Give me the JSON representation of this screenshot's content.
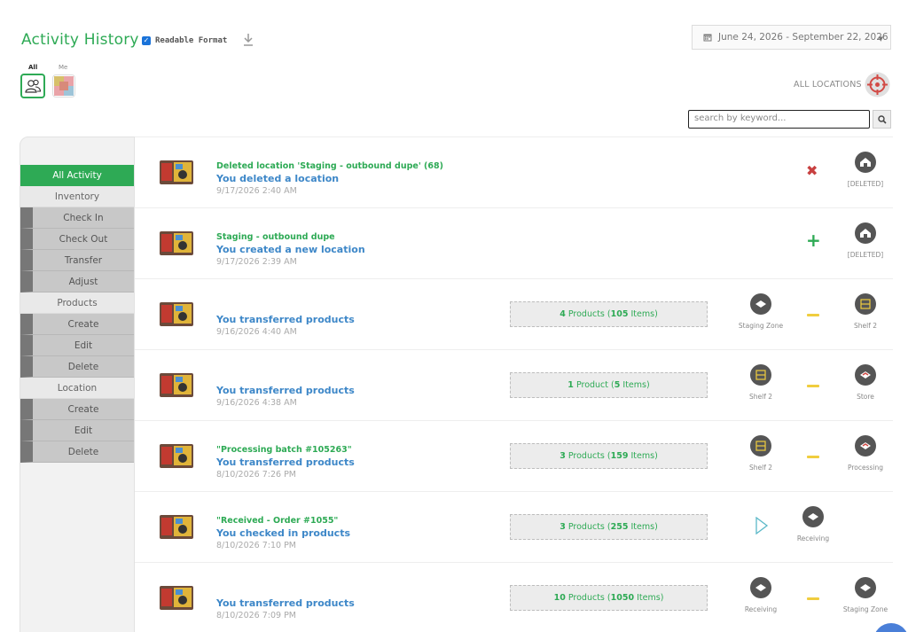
{
  "header": {
    "title": "Activity History",
    "readable_label": "Readable Format",
    "readable_checked": true,
    "date_range": "June 24, 2026 - September 22, 2026"
  },
  "who": {
    "all_label": "All",
    "me_label": "Me"
  },
  "locations": {
    "label": "ALL LOCATIONS"
  },
  "search": {
    "placeholder": "search by keyword..."
  },
  "sidebar": {
    "all_activity": "All Activity",
    "inventory": "Inventory",
    "check_in": "Check In",
    "check_out": "Check Out",
    "transfer": "Transfer",
    "adjust": "Adjust",
    "products": "Products",
    "p_create": "Create",
    "p_edit": "Edit",
    "p_delete": "Delete",
    "location": "Location",
    "l_create": "Create",
    "l_edit": "Edit",
    "l_delete": "Delete"
  },
  "colors": {
    "accent": "#2eaa55",
    "link": "#3d87c8",
    "arrow": "#f0cd3e",
    "delete": "#c84040"
  },
  "rows": [
    {
      "title": "Deleted location 'Staging - outbound dupe' (68)",
      "action": "You deleted a location",
      "time": "9/17/2026 2:40 AM",
      "status_icon": "x-icon",
      "dest_label": "[DELETED]"
    },
    {
      "title": "Staging - outbound dupe",
      "action": "You created a new location",
      "time": "9/17/2026 2:39 AM",
      "status_icon": "plus-icon",
      "dest_label": "[DELETED]"
    },
    {
      "title": "",
      "action": "You transferred products",
      "time": "9/16/2026 4:40 AM",
      "products": "4",
      "products_word": "Products",
      "items": "105",
      "from": "Staging Zone",
      "to": "Shelf 2"
    },
    {
      "title": "",
      "action": "You transferred products",
      "time": "9/16/2026 4:38 AM",
      "products": "1",
      "products_word": "Product",
      "items": "5",
      "from": "Shelf 2",
      "to": "Store"
    },
    {
      "title": "\"Processing batch #105263\"",
      "action": "You transferred products",
      "time": "8/10/2026 7:26 PM",
      "products": "3",
      "products_word": "Products",
      "items": "159",
      "from": "Shelf 2",
      "to": "Processing"
    },
    {
      "title": "\"Received - Order #1055\"",
      "action": "You checked in products",
      "time": "8/10/2026 7:10 PM",
      "products": "3",
      "products_word": "Products",
      "items": "255",
      "to": "Receiving"
    },
    {
      "title": "",
      "action": "You transferred products",
      "time": "8/10/2026 7:09 PM",
      "products": "10",
      "products_word": "Products",
      "items": "1050",
      "from": "Receiving",
      "to": "Staging Zone"
    }
  ],
  "labels": {
    "items": "Items"
  }
}
